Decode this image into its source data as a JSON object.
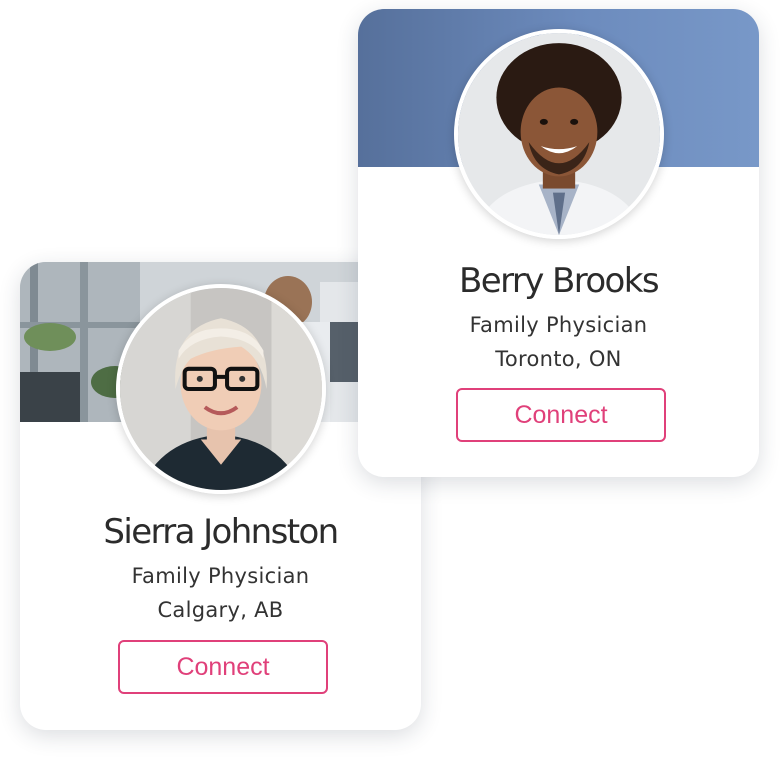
{
  "profiles": [
    {
      "name": "Berry Brooks",
      "title": "Family Physician",
      "location": "Toronto, ON",
      "connect_label": "Connect"
    },
    {
      "name": "Sierra Johnston",
      "title": "Family Physician",
      "location": "Calgary, AB",
      "connect_label": "Connect"
    }
  ],
  "colors": {
    "accent": "#e0407a",
    "banner_blue": "#6c8bbd",
    "name_text": "#2b2b2b"
  }
}
